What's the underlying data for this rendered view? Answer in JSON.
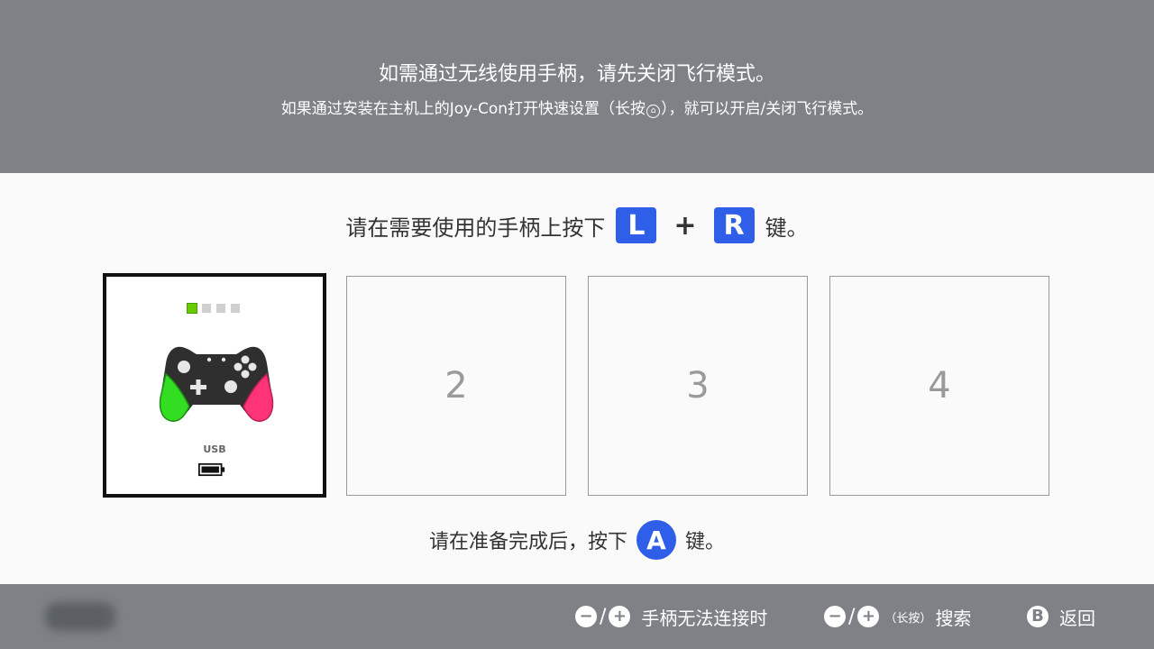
{
  "banner": {
    "line1": "如需通过无线使用手柄，请先关闭飞行模式。",
    "line2_before": "如果通过安装在主机上的Joy-Con打开快速设置（长按",
    "home_icon": "home-icon",
    "line2_after": "），就可以开启/关闭飞行模式。"
  },
  "instruction": {
    "text_before": "请在需要使用的手柄上按下",
    "key_l": "L",
    "plus": "+",
    "key_r": "R",
    "text_after": "键。"
  },
  "slots": {
    "player1": {
      "indicator_icon": "player-lights-icon",
      "controller_icon": "pro-controller-icon",
      "connection": "USB",
      "battery_icon": "battery-icon",
      "battery_level": 1.0,
      "colors": {
        "left_grip": "#33dd22",
        "right_grip": "#ff3377",
        "body": "#2f2f2f",
        "player_light": "#66cc00"
      }
    },
    "slot2": "2",
    "slot3": "3",
    "slot4": "4"
  },
  "confirm": {
    "text_before": "请在准备完成后，按下",
    "key_a": "A",
    "text_after": "键。"
  },
  "footer": {
    "hint1": {
      "minus": "−",
      "slash": "/",
      "plus": "+",
      "label": "手柄无法连接时"
    },
    "hint2": {
      "minus": "−",
      "slash": "/",
      "plus": "+",
      "small": "（长按）",
      "label": "搜索"
    },
    "hint3": {
      "key": "B",
      "label": "返回"
    }
  },
  "colors": {
    "banner_bg": "#7e8287",
    "accent": "#2f5ee8",
    "content_bg": "#fafafa"
  }
}
